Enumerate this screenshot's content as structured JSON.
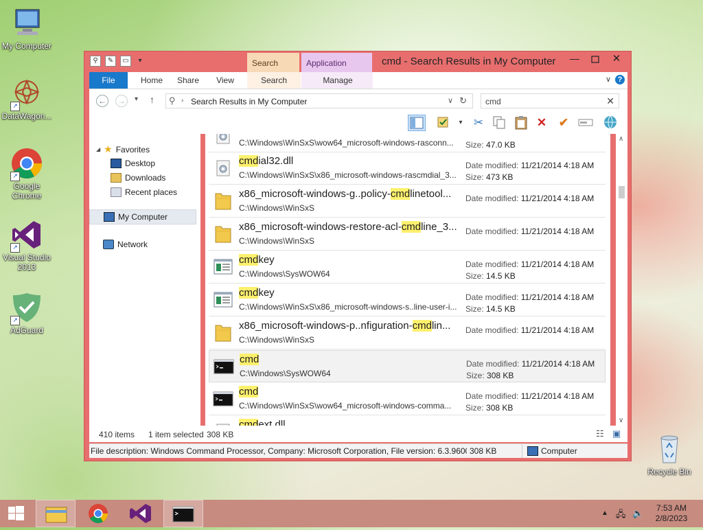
{
  "desktop_icons": [
    {
      "label": "My Computer"
    },
    {
      "label": "DataWagon..."
    },
    {
      "label": "Google Chrome"
    },
    {
      "label": "Visual Studio 2013"
    },
    {
      "label": "AdGuard"
    },
    {
      "label": "Recycle Bin"
    }
  ],
  "window": {
    "title": "cmd - Search Results in My Computer",
    "context_tab_search": "Search Tools",
    "context_tab_app": "Application Tools",
    "min_glyph": "—",
    "close_glyph": "✕"
  },
  "ribbon": {
    "tabs": [
      "File",
      "Home",
      "Share",
      "View",
      "Search",
      "Manage"
    ],
    "collapse_glyph": "∨",
    "help_glyph": "?"
  },
  "address": {
    "path": "Search Results in My Computer",
    "search_value": "cmd",
    "clear_glyph": "✕"
  },
  "nav": {
    "favorites": "Favorites",
    "desktop": "Desktop",
    "downloads": "Downloads",
    "recent": "Recent places",
    "computer": "My Computer",
    "network": "Network"
  },
  "files": [
    {
      "name_pre": "",
      "name_hl": "",
      "name_post": "",
      "path": "C:\\Windows\\WinSxS\\wow64_microsoft-windows-rasconn...",
      "meta1": "",
      "meta1_val": "",
      "meta2": "Size:",
      "meta2_val": "47.0 KB",
      "icon": "dll"
    },
    {
      "name_pre": "",
      "name_hl": "cmd",
      "name_post": "ial32.dll",
      "path": "C:\\Windows\\WinSxS\\x86_microsoft-windows-rascmdial_3...",
      "meta1": "Date modified:",
      "meta1_val": "11/21/2014 4:18 AM",
      "meta2": "Size:",
      "meta2_val": "473 KB",
      "icon": "dll"
    },
    {
      "name_pre": "x86_microsoft-windows-g..policy-",
      "name_hl": "cmd",
      "name_post": "linetool...",
      "path": "C:\\Windows\\WinSxS",
      "meta1": "Date modified:",
      "meta1_val": "11/21/2014 4:18 AM",
      "meta2": "",
      "meta2_val": "",
      "icon": "folder"
    },
    {
      "name_pre": "x86_microsoft-windows-restore-acl-",
      "name_hl": "cmd",
      "name_post": "line_3...",
      "path": "C:\\Windows\\WinSxS",
      "meta1": "Date modified:",
      "meta1_val": "11/21/2014 4:18 AM",
      "meta2": "",
      "meta2_val": "",
      "icon": "folder"
    },
    {
      "name_pre": "",
      "name_hl": "cmd",
      "name_post": "key",
      "path": "C:\\Windows\\SysWOW64",
      "meta1": "Date modified:",
      "meta1_val": "11/21/2014 4:18 AM",
      "meta2": "Size:",
      "meta2_val": "14.5 KB",
      "icon": "app"
    },
    {
      "name_pre": "",
      "name_hl": "cmd",
      "name_post": "key",
      "path": "C:\\Windows\\WinSxS\\x86_microsoft-windows-s..line-user-i...",
      "meta1": "Date modified:",
      "meta1_val": "11/21/2014 4:18 AM",
      "meta2": "Size:",
      "meta2_val": "14.5 KB",
      "icon": "app"
    },
    {
      "name_pre": "x86_microsoft-windows-p..nfiguration-",
      "name_hl": "cmd",
      "name_post": "lin...",
      "path": "C:\\Windows\\WinSxS",
      "meta1": "Date modified:",
      "meta1_val": "11/21/2014 4:18 AM",
      "meta2": "",
      "meta2_val": "",
      "icon": "folder"
    },
    {
      "name_pre": "",
      "name_hl": "cmd",
      "name_post": "",
      "path": "C:\\Windows\\SysWOW64",
      "meta1": "Date modified:",
      "meta1_val": "11/21/2014 4:18 AM",
      "meta2": "Size:",
      "meta2_val": "308 KB",
      "icon": "console",
      "selected": true
    },
    {
      "name_pre": "",
      "name_hl": "cmd",
      "name_post": "",
      "path": "C:\\Windows\\WinSxS\\wow64_microsoft-windows-comma...",
      "meta1": "Date modified:",
      "meta1_val": "11/21/2014 4:18 AM",
      "meta2": "Size:",
      "meta2_val": "308 KB",
      "icon": "console"
    },
    {
      "name_pre": "",
      "name_hl": "cmd",
      "name_post": "ext.dll",
      "path": "",
      "meta1": "Date modified:",
      "meta1_val": "",
      "meta2": "",
      "meta2_val": "",
      "icon": "dll"
    }
  ],
  "status": {
    "count": "410 items",
    "selected": "1 item selected",
    "size": "308 KB"
  },
  "details": {
    "text": "File description: Windows Command Processor, Company: Microsoft Corporation, File version: 6.3.9600",
    "size": "308 KB",
    "location": "Computer"
  },
  "taskbar": {
    "time": "7:53 AM",
    "date": "2/8/2023"
  }
}
